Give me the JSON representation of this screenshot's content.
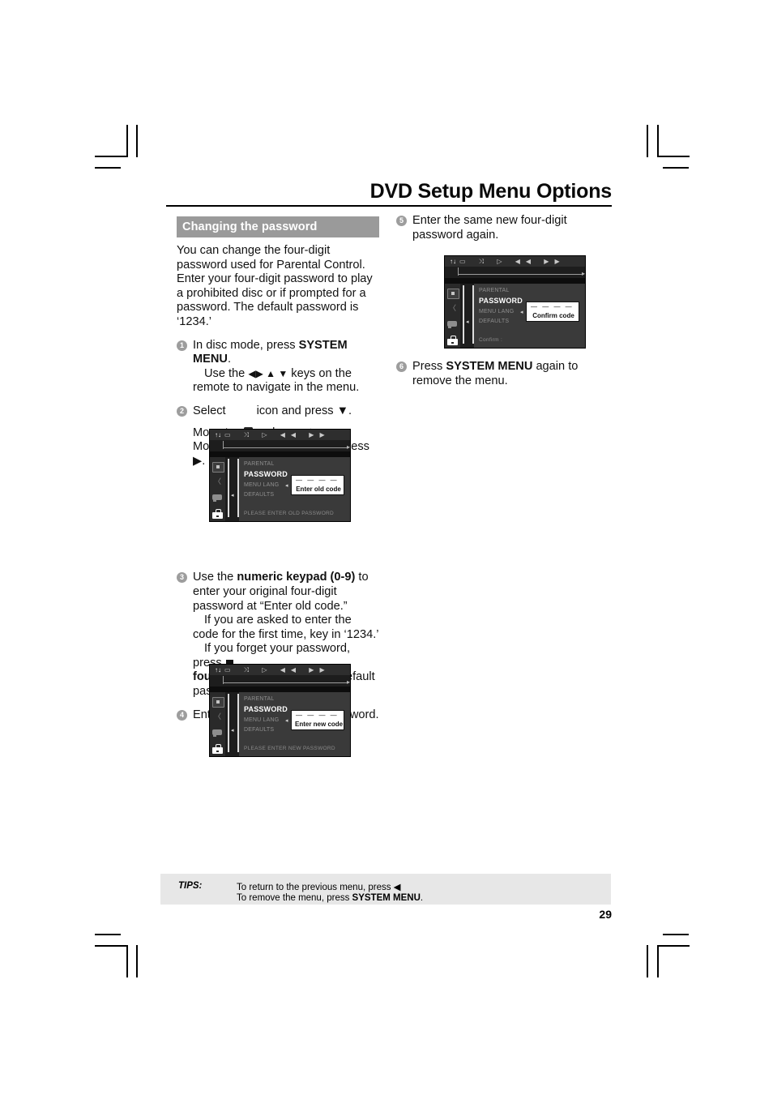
{
  "document": {
    "title": "DVD Setup Menu Options",
    "page_number": "29"
  },
  "left_column": {
    "section_heading": "Changing the password",
    "intro": "You can change the four-digit password used for Parental Control.  Enter your four-digit password to play a prohibited disc or if prompted for a password. The default password is ‘1234.’",
    "steps": [
      {
        "num": "1",
        "line1_a": "In disc mode, press ",
        "line1_b": "SYSTEM MENU",
        "line1_c": ".",
        "line2_a": "Use the ",
        "line2_keys": "◀▶ ▲ ▼",
        "line2_b": " keys on the remote to navigate in the menu."
      },
      {
        "num": "2",
        "line1_a": "Select",
        "line1_b": "icon and press ▼.",
        "line2_a": "Move to",
        "line2_b": "and press ▶.",
        "line3": "Move to {PASSWORD} and press ▶."
      },
      {
        "num": "3",
        "line1_a": "Use the ",
        "line1_b": "numeric keypad (0-9)",
        "line1_c": " to enter your original four-digit password at “Enter old code.”",
        "line2": "If you are asked to enter the code for the first time, key in ‘1234.’",
        "line3_a": "If you forget your password, press",
        "line3_b": "four times",
        "line3_c": " to restore to the default password (1234.)"
      },
      {
        "num": "4",
        "line1": "Enter your new four-digit password."
      }
    ]
  },
  "right_column": {
    "steps": [
      {
        "num": "5",
        "line1": "Enter the same new four-digit password again."
      },
      {
        "num": "6",
        "line1_a": "Press ",
        "line1_b": "SYSTEM MENU",
        "line1_c": " again to remove the menu."
      }
    ]
  },
  "tv_screens": {
    "old_code": {
      "topbar_tl": "↑↓",
      "topbar_icons": "▭  ⤨  ▷  ◀◀  ▶▶",
      "menu_items": [
        "PARENTAL",
        "PASSWORD",
        "MENU LANG",
        "DEFAULTS"
      ],
      "selected_item": "PASSWORD",
      "popup_dashes": "— — — —",
      "popup_label": "Enter old code",
      "status": "PLEASE ENTER OLD PASSWORD"
    },
    "new_code": {
      "topbar_tl": "↑↓",
      "topbar_icons": "▭  ⤨  ▷  ◀◀  ▶▶",
      "menu_items": [
        "PARENTAL",
        "PASSWORD",
        "MENU LANG",
        "DEFAULTS"
      ],
      "selected_item": "PASSWORD",
      "popup_dashes": "— — — —",
      "popup_label": "Enter new code",
      "status": "PLEASE ENTER NEW PASSWORD"
    },
    "confirm_code": {
      "topbar_tl": "↑↓",
      "topbar_icons": "▭  ⤨  ▷  ◀◀  ▶▶",
      "menu_items": [
        "PARENTAL",
        "PASSWORD",
        "MENU LANG",
        "DEFAULTS"
      ],
      "selected_item": "PASSWORD",
      "popup_dashes": "— — — —",
      "popup_label": "Confirm code",
      "status": "Confirm :"
    }
  },
  "tips": {
    "label": "TIPS:",
    "line1": "To return to the previous menu, press ◀",
    "line2_a": "To remove the menu, press ",
    "line2_b": "SYSTEM MENU",
    "line2_c": "."
  }
}
